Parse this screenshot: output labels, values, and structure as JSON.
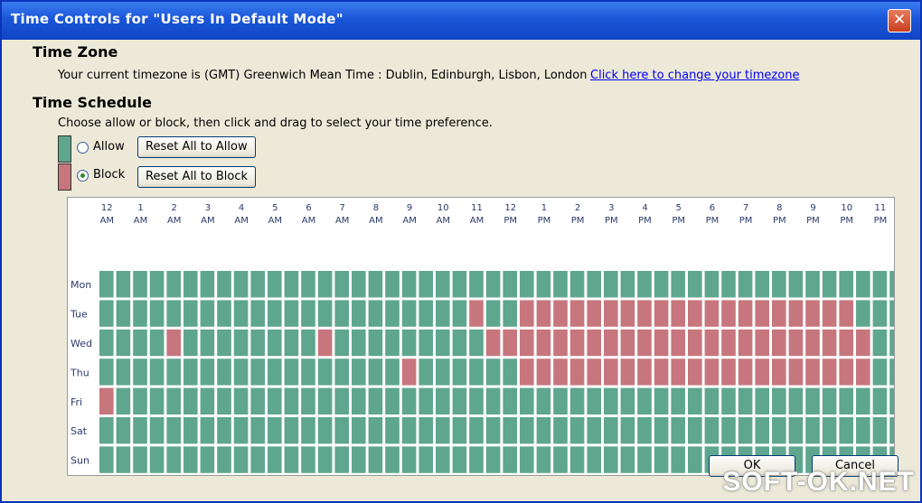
{
  "window": {
    "title": "Time Controls for \"Users In Default Mode\""
  },
  "timezone": {
    "heading": "Time Zone",
    "current_text": "Your current timezone is (GMT) Greenwich Mean Time : Dublin, Edinburgh, Lisbon, London",
    "change_link": "Click here to change your timezone"
  },
  "schedule": {
    "heading": "Time Schedule",
    "instruction": "Choose allow or block, then click and drag to select your time preference.",
    "allow_label": "Allow",
    "block_label": "Block",
    "selected_mode": "block",
    "reset_allow_label": "Reset All to Allow",
    "reset_block_label": "Reset All to Block",
    "hour_labels": [
      [
        "12",
        "AM"
      ],
      [
        "1",
        "AM"
      ],
      [
        "2",
        "AM"
      ],
      [
        "3",
        "AM"
      ],
      [
        "4",
        "AM"
      ],
      [
        "5",
        "AM"
      ],
      [
        "6",
        "AM"
      ],
      [
        "7",
        "AM"
      ],
      [
        "8",
        "AM"
      ],
      [
        "9",
        "AM"
      ],
      [
        "10",
        "AM"
      ],
      [
        "11",
        "AM"
      ],
      [
        "12",
        "PM"
      ],
      [
        "1",
        "PM"
      ],
      [
        "2",
        "PM"
      ],
      [
        "3",
        "PM"
      ],
      [
        "4",
        "PM"
      ],
      [
        "5",
        "PM"
      ],
      [
        "6",
        "PM"
      ],
      [
        "7",
        "PM"
      ],
      [
        "8",
        "PM"
      ],
      [
        "9",
        "PM"
      ],
      [
        "10",
        "PM"
      ],
      [
        "11",
        "PM"
      ]
    ],
    "days": [
      {
        "label": "Mon",
        "blocked_slots": []
      },
      {
        "label": "Tue",
        "blocked_slots": [
          22,
          25,
          26,
          27,
          28,
          29,
          30,
          31,
          32,
          33,
          34,
          35,
          36,
          37,
          38,
          39,
          40,
          41,
          42,
          43,
          44
        ]
      },
      {
        "label": "Wed",
        "blocked_slots": [
          4,
          13,
          23,
          24,
          25,
          26,
          27,
          28,
          29,
          30,
          31,
          32,
          33,
          34,
          35,
          36,
          37,
          38,
          39,
          40,
          41,
          42,
          43,
          44,
          45
        ]
      },
      {
        "label": "Thu",
        "blocked_slots": [
          18,
          25,
          26,
          27,
          28,
          29,
          30,
          31,
          32,
          33,
          34,
          35,
          36,
          37,
          38,
          39,
          40,
          41,
          42,
          43,
          44,
          45
        ]
      },
      {
        "label": "Fri",
        "blocked_slots": [
          0
        ]
      },
      {
        "label": "Sat",
        "blocked_slots": []
      },
      {
        "label": "Sun",
        "blocked_slots": []
      }
    ],
    "allow_color": "#5fa68e",
    "block_color": "#c7767d"
  },
  "footer": {
    "ok_label": "OK",
    "cancel_label": "Cancel"
  },
  "watermark": "SOFT-OK.NET"
}
